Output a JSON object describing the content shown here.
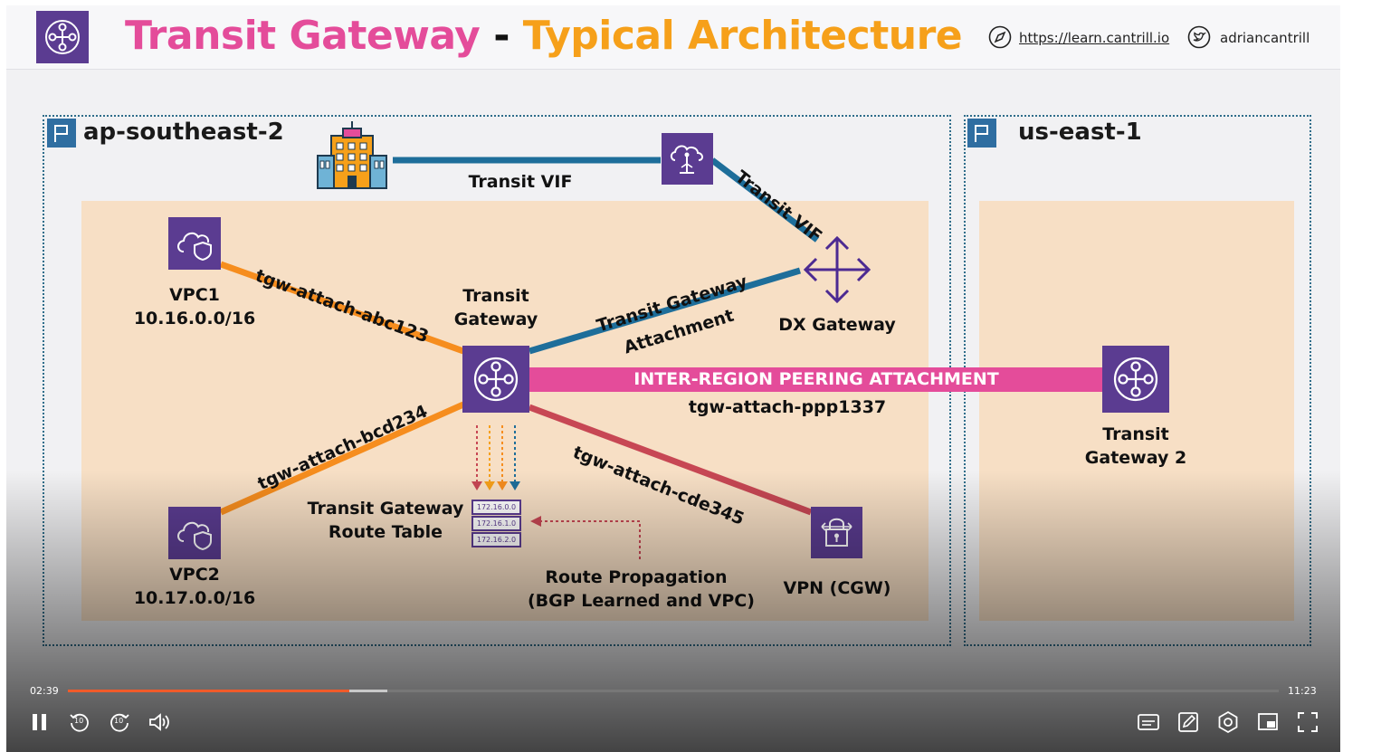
{
  "slide": {
    "title_part1": "Transit Gateway",
    "title_sep": "-",
    "title_part2": "Typical Architecture",
    "website": "https://learn.cantrill.io",
    "twitter": "adriancantrill",
    "colors": {
      "title_pink": "#e44c9a",
      "title_orange": "#f6a01a",
      "tile_purple": "#5b3c91",
      "vif_blue": "#1e6e9a",
      "peering_pink": "#e44c9a",
      "vpc_orange": "#f68d1e",
      "vpn_red": "#c74754"
    }
  },
  "regions": {
    "left": {
      "name": "ap-southeast-2"
    },
    "right": {
      "name": "us-east-1"
    }
  },
  "diagram": {
    "transit_vif_horizontal": "Transit VIF",
    "transit_vif_diagonal": "Transit VIF",
    "vpc1_name": "VPC1",
    "vpc1_cidr": "10.16.0.0/16",
    "vpc2_name": "VPC2",
    "vpc2_cidr": "10.17.0.0/16",
    "tgw_line1": "Transit",
    "tgw_line2": "Gateway",
    "attach_vpc1": "tgw-attach-abc123",
    "attach_vpc2": "tgw-attach-bcd234",
    "attach_vpn": "tgw-attach-cde345",
    "dx_attach_line1": "Transit Gateway",
    "dx_attach_line2": "Attachment",
    "dx_gateway": "DX Gateway",
    "peering_label": "INTER-REGION PEERING ATTACHMENT",
    "peering_attach": "tgw-attach-ppp1337",
    "tgw2_line1": "Transit",
    "tgw2_line2": "Gateway 2",
    "route_table_line1": "Transit Gateway",
    "route_table_line2": "Route Table",
    "route_entries": [
      "172.16.0.0",
      "172.16.1.0",
      "172.16.2.0"
    ],
    "propagation_line1": "Route Propagation",
    "propagation_line2": "(BGP Learned and VPC)",
    "vpn": "VPN (CGW)",
    "icons": [
      "transit-gateway-icon",
      "corporate-building-icon",
      "direct-connect-location-icon",
      "vpc-icon",
      "dx-gateway-icon",
      "vpn-gateway-icon",
      "region-flag-icon",
      "globe-icon",
      "twitter-icon"
    ]
  },
  "player": {
    "current_time": "02:39",
    "total_time": "11:23",
    "progress_fraction": 0.2327,
    "buffered_fraction": 0.264,
    "rewind_label": "10",
    "forward_label": "10",
    "icons": [
      "pause-icon",
      "rewind-10-icon",
      "forward-10-icon",
      "volume-icon",
      "captions-icon",
      "notes-icon",
      "settings-icon",
      "picture-in-picture-icon",
      "fullscreen-icon"
    ]
  }
}
